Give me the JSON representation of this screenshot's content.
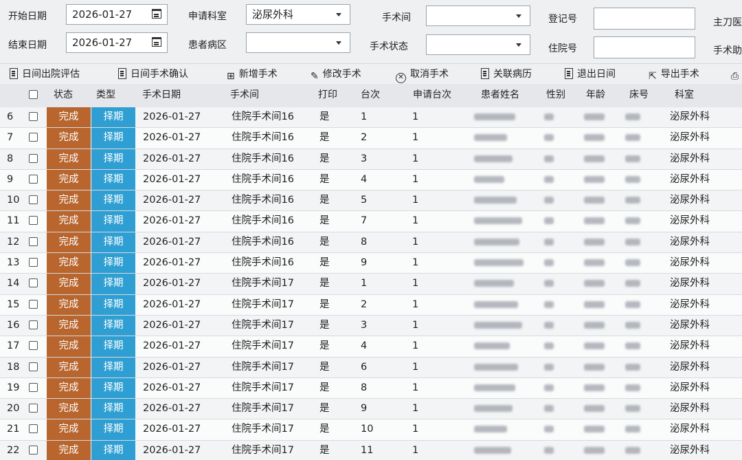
{
  "filters": {
    "start_date_label": "开始日期",
    "start_date_value": "2026-01-27",
    "end_date_label": "结束日期",
    "end_date_value": "2026-01-27",
    "dept_label": "申请科室",
    "dept_value": "泌尿外科",
    "ward_label": "患者病区",
    "ward_value": "",
    "room_label": "手术间",
    "room_value": "",
    "status_label": "手术状态",
    "status_value": "",
    "reg_label": "登记号",
    "reg_value": "",
    "inpatient_label": "住院号",
    "inpatient_value": "",
    "surgeon_label": "主刀医",
    "extra_label": "手术助"
  },
  "toolbar": {
    "buttons": [
      {
        "label": "日间出院评估",
        "icon": "document-icon"
      },
      {
        "label": "日间手术确认",
        "icon": "document-icon"
      },
      {
        "label": "新增手术",
        "icon": "add-icon"
      },
      {
        "label": "修改手术",
        "icon": "edit-icon"
      },
      {
        "label": "取消手术",
        "icon": "cancel-icon"
      },
      {
        "label": "关联病历",
        "icon": "document-icon"
      },
      {
        "label": "退出日间",
        "icon": "document-icon"
      },
      {
        "label": "导出手术",
        "icon": "export-icon"
      }
    ]
  },
  "table": {
    "headers": [
      "状态",
      "类型",
      "手术日期",
      "手术间",
      "打印",
      "台次",
      "申请台次",
      "患者姓名",
      "性别",
      "年龄",
      "床号",
      "科室"
    ],
    "status_colors": {
      "完成": "#b8652e"
    },
    "type_colors": {
      "择期": "#2f9fd3"
    },
    "rows": [
      {
        "no": "6",
        "status": "完成",
        "type": "择期",
        "date": "2026-01-27",
        "room": "住院手术间16",
        "print": "是",
        "seq": "1",
        "apply_seq": "1",
        "dept": "泌尿外科"
      },
      {
        "no": "7",
        "status": "完成",
        "type": "择期",
        "date": "2026-01-27",
        "room": "住院手术间16",
        "print": "是",
        "seq": "2",
        "apply_seq": "1",
        "dept": "泌尿外科"
      },
      {
        "no": "8",
        "status": "完成",
        "type": "择期",
        "date": "2026-01-27",
        "room": "住院手术间16",
        "print": "是",
        "seq": "3",
        "apply_seq": "1",
        "dept": "泌尿外科"
      },
      {
        "no": "9",
        "status": "完成",
        "type": "择期",
        "date": "2026-01-27",
        "room": "住院手术间16",
        "print": "是",
        "seq": "4",
        "apply_seq": "1",
        "dept": "泌尿外科"
      },
      {
        "no": "10",
        "status": "完成",
        "type": "择期",
        "date": "2026-01-27",
        "room": "住院手术间16",
        "print": "是",
        "seq": "5",
        "apply_seq": "1",
        "dept": "泌尿外科"
      },
      {
        "no": "11",
        "status": "完成",
        "type": "择期",
        "date": "2026-01-27",
        "room": "住院手术间16",
        "print": "是",
        "seq": "7",
        "apply_seq": "1",
        "dept": "泌尿外科"
      },
      {
        "no": "12",
        "status": "完成",
        "type": "择期",
        "date": "2026-01-27",
        "room": "住院手术间16",
        "print": "是",
        "seq": "8",
        "apply_seq": "1",
        "dept": "泌尿外科"
      },
      {
        "no": "13",
        "status": "完成",
        "type": "择期",
        "date": "2026-01-27",
        "room": "住院手术间16",
        "print": "是",
        "seq": "9",
        "apply_seq": "1",
        "dept": "泌尿外科"
      },
      {
        "no": "14",
        "status": "完成",
        "type": "择期",
        "date": "2026-01-27",
        "room": "住院手术间17",
        "print": "是",
        "seq": "1",
        "apply_seq": "1",
        "dept": "泌尿外科"
      },
      {
        "no": "15",
        "status": "完成",
        "type": "择期",
        "date": "2026-01-27",
        "room": "住院手术间17",
        "print": "是",
        "seq": "2",
        "apply_seq": "1",
        "dept": "泌尿外科"
      },
      {
        "no": "16",
        "status": "完成",
        "type": "择期",
        "date": "2026-01-27",
        "room": "住院手术间17",
        "print": "是",
        "seq": "3",
        "apply_seq": "1",
        "dept": "泌尿外科"
      },
      {
        "no": "17",
        "status": "完成",
        "type": "择期",
        "date": "2026-01-27",
        "room": "住院手术间17",
        "print": "是",
        "seq": "4",
        "apply_seq": "1",
        "dept": "泌尿外科"
      },
      {
        "no": "18",
        "status": "完成",
        "type": "择期",
        "date": "2026-01-27",
        "room": "住院手术间17",
        "print": "是",
        "seq": "6",
        "apply_seq": "1",
        "dept": "泌尿外科"
      },
      {
        "no": "19",
        "status": "完成",
        "type": "择期",
        "date": "2026-01-27",
        "room": "住院手术间17",
        "print": "是",
        "seq": "8",
        "apply_seq": "1",
        "dept": "泌尿外科"
      },
      {
        "no": "20",
        "status": "完成",
        "type": "择期",
        "date": "2026-01-27",
        "room": "住院手术间17",
        "print": "是",
        "seq": "9",
        "apply_seq": "1",
        "dept": "泌尿外科"
      },
      {
        "no": "21",
        "status": "完成",
        "type": "择期",
        "date": "2026-01-27",
        "room": "住院手术间17",
        "print": "是",
        "seq": "10",
        "apply_seq": "1",
        "dept": "泌尿外科"
      },
      {
        "no": "22",
        "status": "完成",
        "type": "择期",
        "date": "2026-01-27",
        "room": "住院手术间17",
        "print": "是",
        "seq": "11",
        "apply_seq": "1",
        "dept": "泌尿外科"
      }
    ]
  }
}
